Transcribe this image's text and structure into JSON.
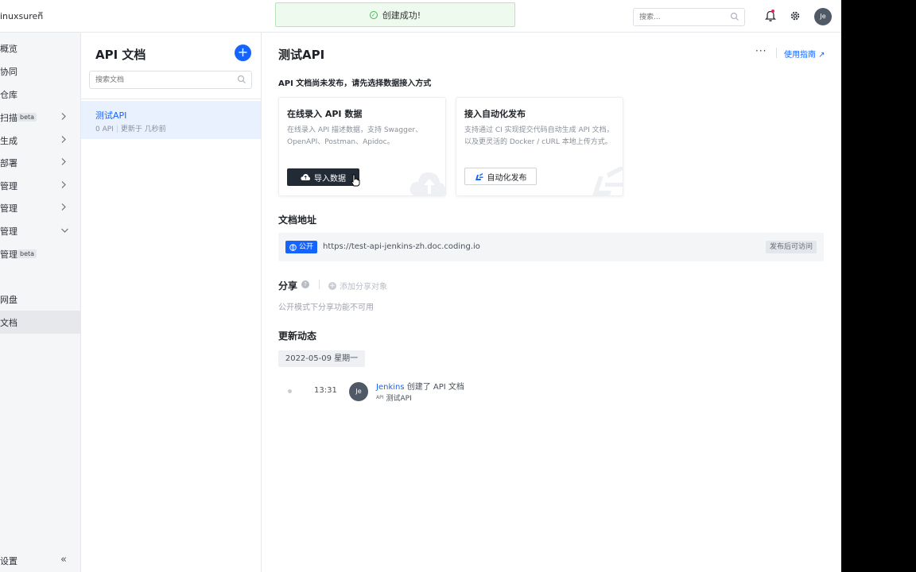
{
  "topbar": {
    "project_name": "inuxsuren",
    "toast_message": "创建成功!",
    "search_placeholder": "搜索...",
    "avatar_initials": "Je"
  },
  "leftnav": {
    "items": [
      {
        "label": "概览",
        "beta": "",
        "chevron": ""
      },
      {
        "label": "协同",
        "beta": "",
        "chevron": ""
      },
      {
        "label": "仓库",
        "beta": "",
        "chevron": ""
      },
      {
        "label": "扫描",
        "beta": "beta",
        "chevron": "right"
      },
      {
        "label": "生成",
        "beta": "",
        "chevron": "right"
      },
      {
        "label": "部署",
        "beta": "",
        "chevron": "right"
      },
      {
        "label": "管理",
        "beta": "",
        "chevron": "right"
      },
      {
        "label": "管理",
        "beta": "",
        "chevron": "right"
      },
      {
        "label": "管理",
        "beta": "",
        "chevron": "down"
      },
      {
        "label": "管理",
        "beta": "beta",
        "chevron": ""
      },
      {
        "label": "网盘",
        "beta": "",
        "chevron": ""
      },
      {
        "label": "文档",
        "beta": "",
        "chevron": "",
        "active": true
      }
    ],
    "settings_label": "设置",
    "collapse_glyph": "«"
  },
  "doclist": {
    "title": "API 文档",
    "add_glyph": "+",
    "search_placeholder": "搜索文档",
    "items": [
      {
        "name": "测试API",
        "count": "0 API",
        "updated": "更新于 几秒前"
      }
    ]
  },
  "main": {
    "title": "测试API",
    "more_glyph": "···",
    "guide_label": "使用指南 ↗",
    "notice": "API 文档尚未发布，请先选择数据接入方式",
    "card_online": {
      "title": "在线录入 API 数据",
      "desc": "在线录入 API 描述数据，支持 Swagger、OpenAPI、Postman、Apidoc。",
      "button": "导入数据"
    },
    "card_auto": {
      "title": "接入自动化发布",
      "desc": "支持通过 CI 实现提交代码自动生成 API 文档，以及更灵活的 Docker / cURL 本地上传方式。",
      "button": "自动化发布"
    },
    "address": {
      "title": "文档地址",
      "badge": "公开",
      "url": "https://test-api-jenkins-zh.doc.coding.io",
      "status": "发布后可访问"
    },
    "share": {
      "title": "分享",
      "add_label": "添加分享对象",
      "note": "公开模式下分享功能不可用"
    },
    "updates": {
      "title": "更新动态",
      "date": "2022-05-09 星期一",
      "entries": [
        {
          "time": "13:31",
          "avatar": "Je",
          "user": "Jenkins",
          "action": " 创建了 API 文档",
          "api_tag": "API",
          "doc": "测试API"
        }
      ]
    }
  },
  "colors": {
    "primary": "#1664ff",
    "toast_bg": "#eefaee",
    "dark_button": "#222a35",
    "sidebar_bg": "#f5f6f8"
  }
}
